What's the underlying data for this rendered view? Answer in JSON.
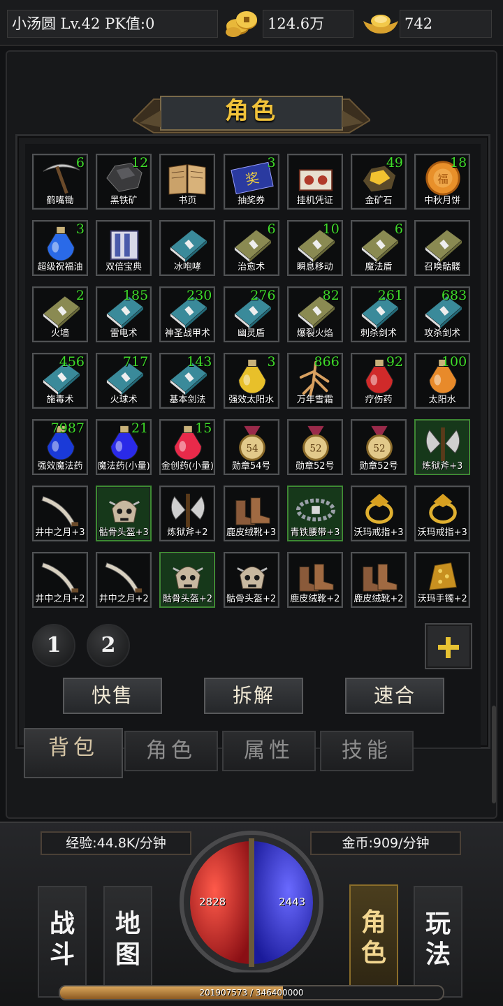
{
  "player": {
    "name_level": "小汤圆  Lv.42 PK值:0"
  },
  "currency": {
    "gold": "124.6万",
    "ingot": "742"
  },
  "title": "角色",
  "items": [
    {
      "name": "鹤嘴锄",
      "count": "6",
      "icon": "pickaxe",
      "highlight": false
    },
    {
      "name": "黑铁矿",
      "count": "12",
      "icon": "ore",
      "highlight": false
    },
    {
      "name": "书页",
      "count": "",
      "icon": "book-open",
      "highlight": false
    },
    {
      "name": "抽奖券",
      "count": "3",
      "icon": "ticket",
      "highlight": false
    },
    {
      "name": "挂机凭证",
      "count": "",
      "icon": "voucher",
      "highlight": false
    },
    {
      "name": "金矿石",
      "count": "49",
      "icon": "gold-ore",
      "highlight": false
    },
    {
      "name": "中秋月饼",
      "count": "18",
      "icon": "mooncake",
      "highlight": false
    },
    {
      "name": "超级祝福油",
      "count": "3",
      "icon": "potion-blue",
      "highlight": false
    },
    {
      "name": "双倍宝典",
      "count": "",
      "icon": "scroll-case",
      "highlight": false
    },
    {
      "name": "冰咆哮",
      "count": "",
      "icon": "book-teal",
      "highlight": false
    },
    {
      "name": "治愈术",
      "count": "6",
      "icon": "book-olive",
      "highlight": false
    },
    {
      "name": "瞬息移动",
      "count": "10",
      "icon": "book-olive",
      "highlight": false
    },
    {
      "name": "魔法盾",
      "count": "6",
      "icon": "book-olive",
      "highlight": false
    },
    {
      "name": "召唤骷髅",
      "count": "",
      "icon": "book-olive",
      "highlight": false
    },
    {
      "name": "火墙",
      "count": "2",
      "icon": "book-olive",
      "highlight": false
    },
    {
      "name": "雷电术",
      "count": "185",
      "icon": "book-teal",
      "highlight": false
    },
    {
      "name": "神圣战甲术",
      "count": "230",
      "icon": "book-teal",
      "highlight": false
    },
    {
      "name": "幽灵盾",
      "count": "276",
      "icon": "book-teal",
      "highlight": false
    },
    {
      "name": "爆裂火焰",
      "count": "82",
      "icon": "book-olive",
      "highlight": false
    },
    {
      "name": "刺杀剑术",
      "count": "261",
      "icon": "book-teal",
      "highlight": false
    },
    {
      "name": "攻杀剑术",
      "count": "683",
      "icon": "book-teal",
      "highlight": false
    },
    {
      "name": "施毒术",
      "count": "456",
      "icon": "book-teal",
      "highlight": false
    },
    {
      "name": "火球术",
      "count": "717",
      "icon": "book-teal",
      "highlight": false
    },
    {
      "name": "基本剑法",
      "count": "143",
      "icon": "book-teal",
      "highlight": false
    },
    {
      "name": "强效太阳水",
      "count": "3",
      "icon": "potion-yellow",
      "highlight": false
    },
    {
      "name": "万年雪霜",
      "count": "866",
      "icon": "root",
      "highlight": false
    },
    {
      "name": "疗伤药",
      "count": "92",
      "icon": "potion-red",
      "highlight": false
    },
    {
      "name": "太阳水",
      "count": "100",
      "icon": "potion-orange",
      "highlight": false
    },
    {
      "name": "强效魔法药",
      "count": "7987",
      "icon": "potion-blue-red",
      "highlight": false
    },
    {
      "name": "魔法药(小量)",
      "count": "21",
      "icon": "potion-blue-small",
      "highlight": false
    },
    {
      "name": "金创药(小量)",
      "count": "15",
      "icon": "potion-red-small",
      "highlight": false
    },
    {
      "name": "勋章54号",
      "count": "",
      "icon": "medal-54",
      "highlight": false
    },
    {
      "name": "勋章52号",
      "count": "",
      "icon": "medal-52",
      "highlight": false
    },
    {
      "name": "勋章52号",
      "count": "",
      "icon": "medal-52",
      "highlight": false
    },
    {
      "name": "炼狱斧+3",
      "count": "",
      "icon": "axe",
      "highlight": true
    },
    {
      "name": "井中之月+3",
      "count": "",
      "icon": "blade",
      "highlight": false
    },
    {
      "name": "骷骨头盔+3",
      "count": "",
      "icon": "skull-helm",
      "highlight": true
    },
    {
      "name": "炼狱斧+2",
      "count": "",
      "icon": "axe",
      "highlight": false
    },
    {
      "name": "鹿皮绒靴+3",
      "count": "",
      "icon": "boots",
      "highlight": false
    },
    {
      "name": "青铁腰带+3",
      "count": "",
      "icon": "belt",
      "highlight": true
    },
    {
      "name": "沃玛戒指+3",
      "count": "",
      "icon": "ring",
      "highlight": false
    },
    {
      "name": "沃玛戒指+3",
      "count": "",
      "icon": "ring",
      "highlight": false
    },
    {
      "name": "井中之月+2",
      "count": "",
      "icon": "blade",
      "highlight": false
    },
    {
      "name": "井中之月+2",
      "count": "",
      "icon": "blade",
      "highlight": false
    },
    {
      "name": "骷骨头盔+2",
      "count": "",
      "icon": "skull-helm",
      "highlight": true
    },
    {
      "name": "骷骨头盔+2",
      "count": "",
      "icon": "skull-helm",
      "highlight": false
    },
    {
      "name": "鹿皮绒靴+2",
      "count": "",
      "icon": "boots",
      "highlight": false
    },
    {
      "name": "鹿皮绒靴+2",
      "count": "",
      "icon": "boots",
      "highlight": false
    },
    {
      "name": "沃玛手镯+2",
      "count": "",
      "icon": "bracelet",
      "highlight": false
    }
  ],
  "pages": [
    "1",
    "2"
  ],
  "actions": {
    "quick_sell": "快售",
    "dismantle": "拆解",
    "combine": "速合"
  },
  "tabs": {
    "bag": "背包",
    "role": "角色",
    "attributes": "属性",
    "skills": "技能"
  },
  "hud": {
    "exp_rate": "经验:44.8K/分钟",
    "gold_rate": "金币:909/分钟",
    "hp": "2828",
    "mp": "2443",
    "exp_text": "201907573 / 346400000",
    "exp_progress": 0.583,
    "nav": {
      "battle": [
        "战",
        "斗"
      ],
      "map": [
        "地",
        "图"
      ],
      "role": [
        "角",
        "色"
      ],
      "play": [
        "玩",
        "法"
      ]
    }
  },
  "colors": {
    "accent_gold": "#f0c23a",
    "count_green": "#3fdc2a",
    "hp_red": "#d0202a",
    "mp_blue": "#2a2ed8"
  }
}
